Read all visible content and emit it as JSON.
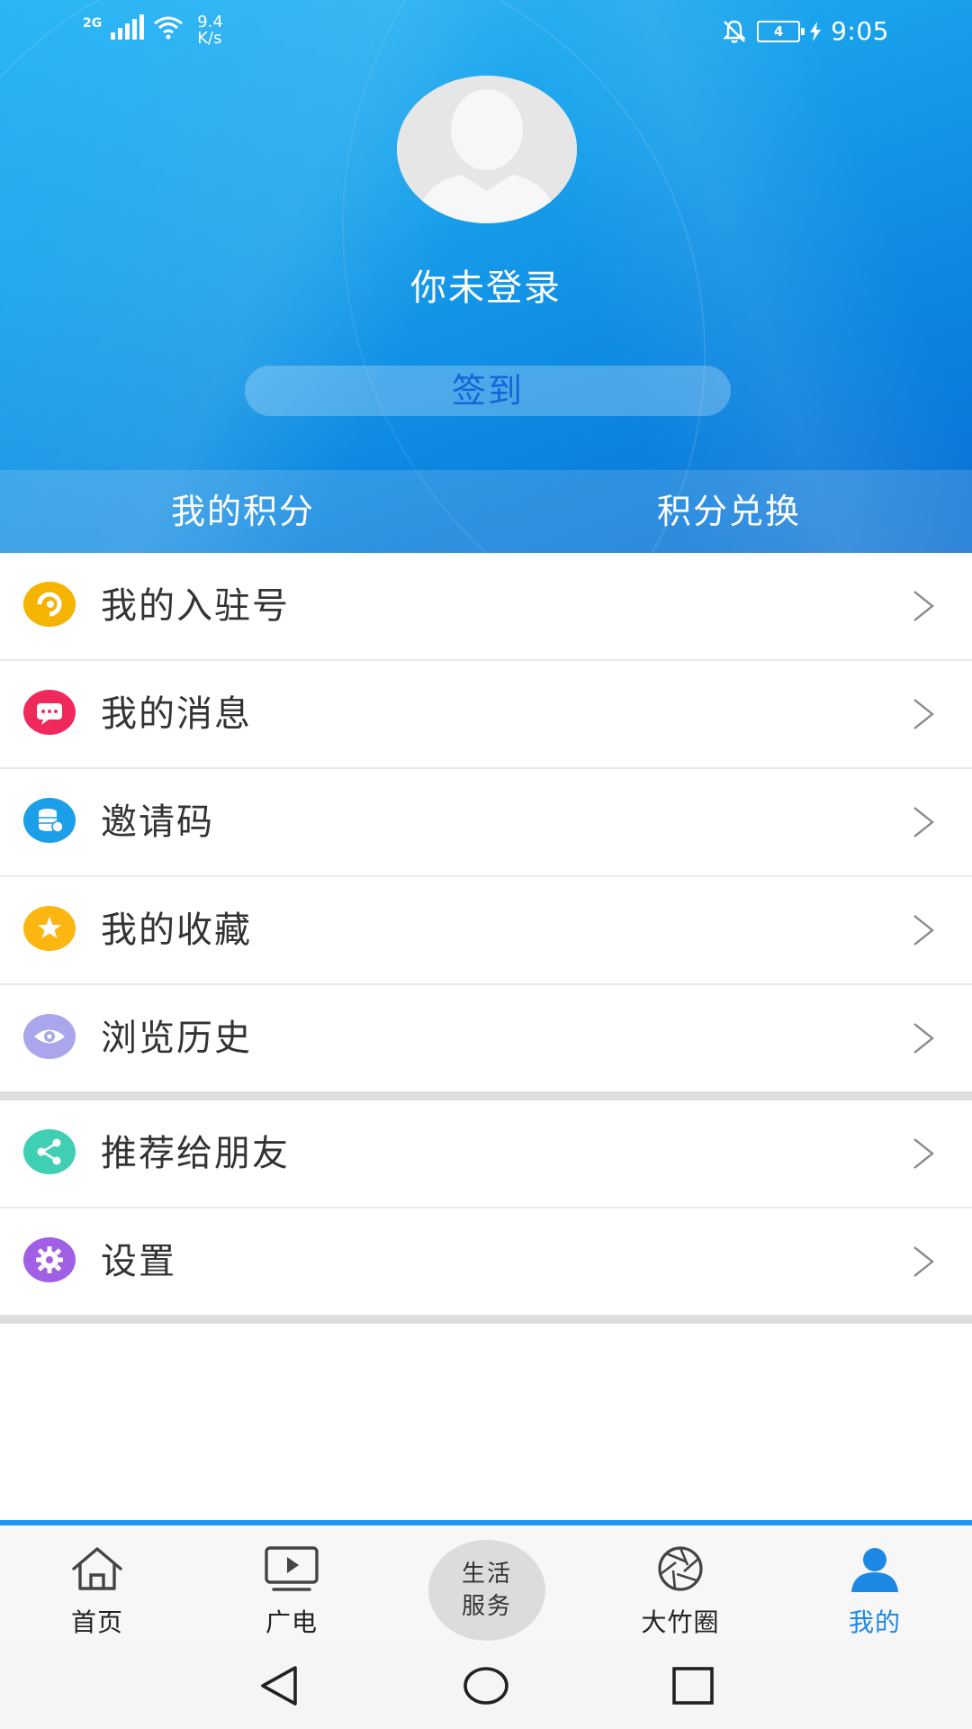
{
  "status_bar": {
    "network": "2G",
    "speed_value": "9.4",
    "speed_unit": "K/s",
    "battery": "4",
    "time": "9:05"
  },
  "profile": {
    "login_text": "你未登录",
    "signin_label": "签到"
  },
  "points": {
    "my_points": "我的积分",
    "exchange": "积分兑换"
  },
  "menu": {
    "items": [
      {
        "label": "我的入驻号",
        "icon": "account-icon",
        "color": "#f5b400"
      },
      {
        "label": "我的消息",
        "icon": "message-icon",
        "color": "#f0295c"
      },
      {
        "label": "邀请码",
        "icon": "coin-stack-icon",
        "color": "#1a9fe8"
      },
      {
        "label": "我的收藏",
        "icon": "star-icon",
        "color": "#fbb612"
      },
      {
        "label": "浏览历史",
        "icon": "eye-icon",
        "color": "#a9a6ec"
      }
    ],
    "items2": [
      {
        "label": "推荐给朋友",
        "icon": "share-icon",
        "color": "#3fd0b4"
      },
      {
        "label": "设置",
        "icon": "gear-icon",
        "color": "#a15fe6"
      }
    ]
  },
  "tabs": [
    {
      "label": "首页",
      "icon": "home-icon"
    },
    {
      "label": "广电",
      "icon": "tv-play-icon"
    },
    {
      "label_line1": "生活",
      "label_line2": "服务"
    },
    {
      "label": "大竹圈",
      "icon": "aperture-icon"
    },
    {
      "label": "我的",
      "icon": "user-icon",
      "active": true
    }
  ],
  "colors": {
    "accent": "#1e88e5",
    "header_top": "#29b6f6",
    "header_bottom": "#0b6fd4"
  }
}
